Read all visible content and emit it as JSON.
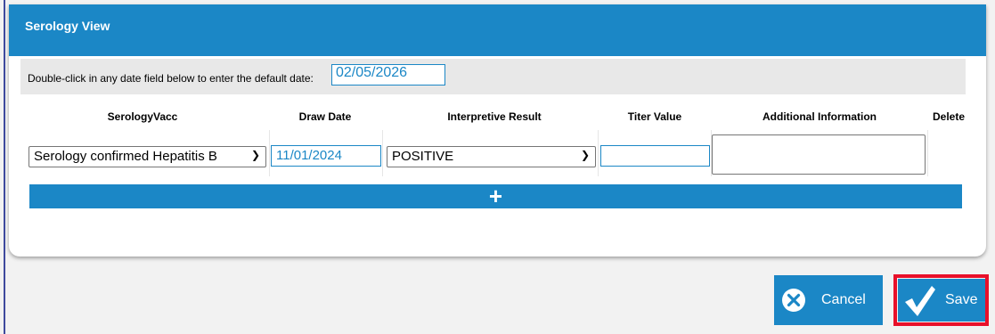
{
  "modal": {
    "title": "Serology View"
  },
  "default_date": {
    "label": "Double-click in any date field below to enter the default date:",
    "value": "02/05/2026"
  },
  "table": {
    "columns": [
      "SerologyVacc",
      "Draw Date",
      "Interpretive Result",
      "Titer Value",
      "Additional Information",
      "Delete"
    ],
    "rows": [
      {
        "serology_vacc": "Serology confirmed Hepatitis B",
        "draw_date": "11/01/2024",
        "interpretive_result": "POSITIVE",
        "titer_value": "",
        "additional_information": ""
      }
    ],
    "add_row_label": "+"
  },
  "footer": {
    "cancel_label": "Cancel",
    "save_label": "Save"
  },
  "colors": {
    "accent": "#1b87c6",
    "highlight": "#e8102a"
  },
  "icons": {
    "cancel": "close-circle-icon",
    "save": "checkmark-icon",
    "dropdown": "chevron-down-icon",
    "add": "plus-icon"
  }
}
